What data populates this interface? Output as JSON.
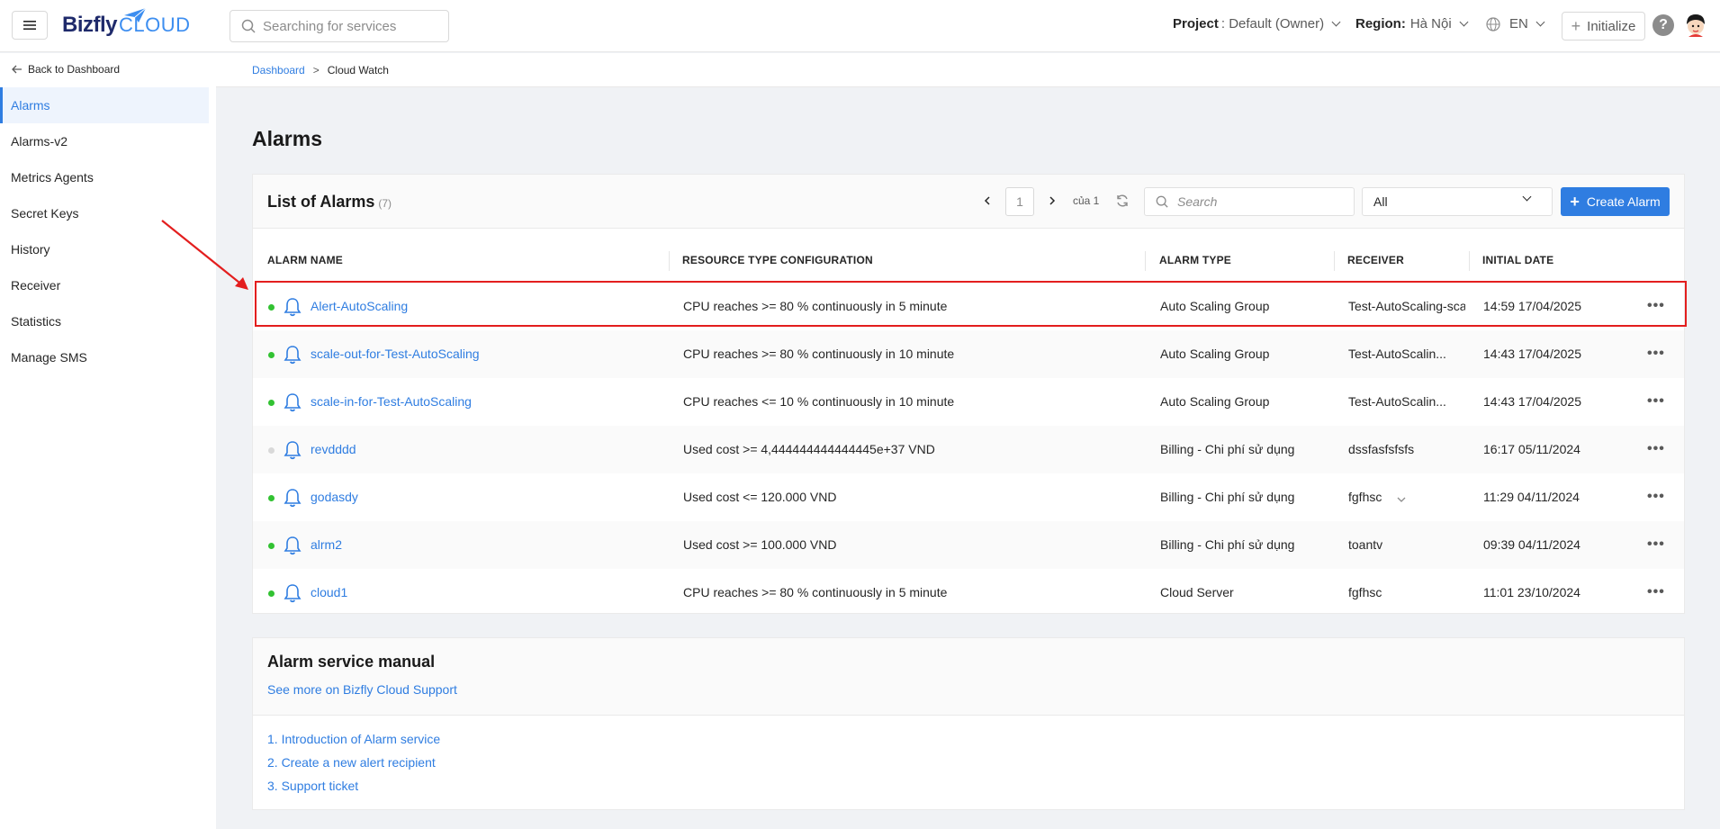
{
  "header": {
    "logo_text": "Bizfly",
    "logo_cloud": "CLOUD",
    "search_placeholder": "Searching for services",
    "project_label": "Project",
    "project_value": ": Default (Owner)",
    "region_label": "Region:",
    "region_value": "Hà Nội",
    "language": "EN",
    "initialize_label": "Initialize",
    "help": "?"
  },
  "sidebar": {
    "back_label": "Back to Dashboard",
    "items": [
      {
        "label": "Alarms",
        "active": true
      },
      {
        "label": "Alarms-v2"
      },
      {
        "label": "Metrics Agents"
      },
      {
        "label": "Secret Keys"
      },
      {
        "label": "History"
      },
      {
        "label": "Receiver"
      },
      {
        "label": "Statistics"
      },
      {
        "label": "Manage SMS"
      }
    ]
  },
  "breadcrumb": {
    "parent": "Dashboard",
    "separator": ">",
    "current": "Cloud Watch"
  },
  "page_title": "Alarms",
  "list": {
    "title": "List of Alarms",
    "count": "(7)",
    "page": "1",
    "page_of": "của 1",
    "search_placeholder": "Search",
    "filter_value": "All",
    "create_label": "Create Alarm",
    "columns": [
      "ALARM NAME",
      "RESOURCE TYPE CONFIGURATION",
      "ALARM TYPE",
      "RECEIVER",
      "INITIAL DATE"
    ],
    "rows": [
      {
        "name": "Alert-AutoScaling",
        "config": "CPU reaches >= 80 % continuously in 5 minute",
        "type": "Auto Scaling Group",
        "receiver": "Test-AutoScaling-sca",
        "date": "14:59 17/04/2025",
        "enabled": true
      },
      {
        "name": "scale-out-for-Test-AutoScaling",
        "config": "CPU reaches >= 80 % continuously in 10 minute",
        "type": "Auto Scaling Group",
        "receiver": "Test-AutoScalin...",
        "date": "14:43 17/04/2025",
        "enabled": true
      },
      {
        "name": "scale-in-for-Test-AutoScaling",
        "config": "CPU reaches <= 10 % continuously in 10 minute",
        "type": "Auto Scaling Group",
        "receiver": "Test-AutoScalin...",
        "date": "14:43 17/04/2025",
        "enabled": true
      },
      {
        "name": "revdddd",
        "config": "Used cost >= 4,444444444444445e+37 VND",
        "type": "Billing - Chi phí sử dụng",
        "receiver": "dssfasfsfsfs",
        "date": "16:17 05/11/2024",
        "enabled": false
      },
      {
        "name": "godasdy",
        "config": "Used cost <= 120.000 VND",
        "type": "Billing - Chi phí sử dụng",
        "receiver": "fgfhsc",
        "date": "11:29 04/11/2024",
        "enabled": true
      },
      {
        "name": "alrm2",
        "config": "Used cost >= 100.000 VND",
        "type": "Billing - Chi phí sử dụng",
        "receiver": "toantv",
        "date": "09:39 04/11/2024",
        "enabled": true
      },
      {
        "name": "cloud1",
        "config": "CPU reaches >= 80 % continuously in 5 minute",
        "type": "Cloud Server",
        "receiver": "fgfhsc",
        "date": "11:01 23/10/2024",
        "enabled": true
      }
    ]
  },
  "manual": {
    "title": "Alarm service manual",
    "support_link": "See more on Bizfly Cloud Support",
    "links": [
      "1. Introduction of Alarm service",
      "2. Create a new alert recipient",
      "3. Support ticket"
    ]
  },
  "colors": {
    "accent": "#2f7de1",
    "enabled_dot": "#32c232",
    "disabled_dot": "#d9d9d9",
    "highlight": "#e31e1e"
  }
}
